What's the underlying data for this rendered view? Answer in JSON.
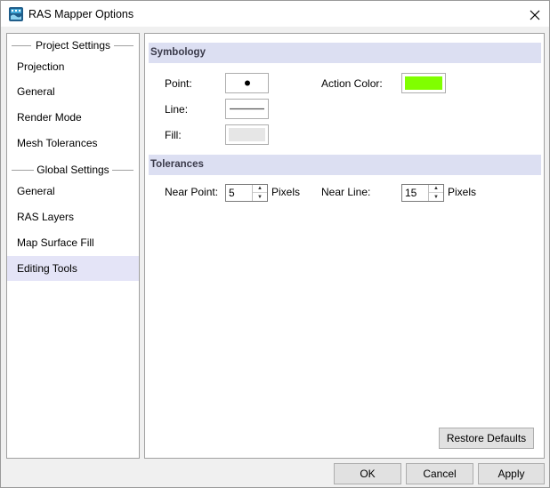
{
  "window": {
    "title": "RAS Mapper Options"
  },
  "nav": {
    "project_header": "Project Settings",
    "project_items": [
      "Projection",
      "General",
      "Render Mode",
      "Mesh Tolerances"
    ],
    "global_header": "Global Settings",
    "global_items": [
      "General",
      "RAS Layers",
      "Map Surface Fill",
      "Editing Tools"
    ],
    "selected": "Editing Tools"
  },
  "symbology": {
    "header": "Symbology",
    "point_label": "Point:",
    "line_label": "Line:",
    "fill_label": "Fill:",
    "action_color_label": "Action Color:",
    "action_color": "#80ff00",
    "fill_color": "#e6e6e6",
    "line_color": "#555555",
    "point_color": "#000000"
  },
  "tolerances": {
    "header": "Tolerances",
    "near_point_label": "Near Point:",
    "near_point_value": "5",
    "near_line_label": "Near Line:",
    "near_line_value": "15",
    "units_label": "Pixels"
  },
  "buttons": {
    "restore": "Restore Defaults",
    "ok": "OK",
    "cancel": "Cancel",
    "apply": "Apply"
  }
}
